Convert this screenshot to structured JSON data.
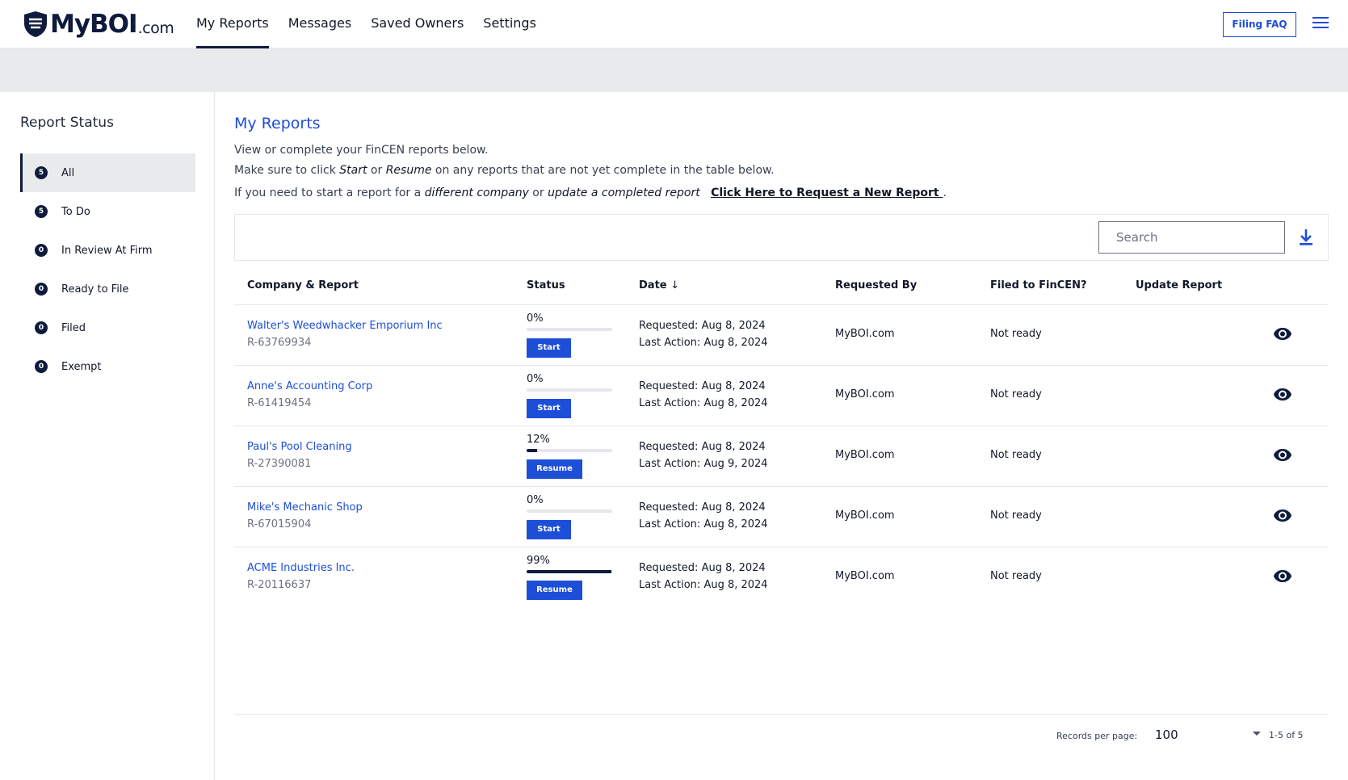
{
  "header": {
    "logo_brand": "MyBOI",
    "logo_suffix": ".com",
    "nav": [
      {
        "label": "My Reports",
        "active": true
      },
      {
        "label": "Messages",
        "active": false
      },
      {
        "label": "Saved Owners",
        "active": false
      },
      {
        "label": "Settings",
        "active": false
      }
    ],
    "faq_label": "Filing FAQ",
    "menu_icon": "hamburger-icon"
  },
  "sidebar": {
    "title": "Report Status",
    "items": [
      {
        "count": "5",
        "label": "All",
        "active": true
      },
      {
        "count": "5",
        "label": "To Do",
        "active": false
      },
      {
        "count": "0",
        "label": "In Review At Firm",
        "active": false
      },
      {
        "count": "0",
        "label": "Ready to File",
        "active": false
      },
      {
        "count": "0",
        "label": "Filed",
        "active": false
      },
      {
        "count": "0",
        "label": "Exempt",
        "active": false
      }
    ]
  },
  "main": {
    "title": "My Reports",
    "line1": "View or complete your FinCEN reports below.",
    "line2_a": "Make sure to click ",
    "line2_b": "Start",
    "line2_c": " or ",
    "line2_d": "Resume",
    "line2_e": " on any reports that are not yet complete in the table below.",
    "line3_a": "If you need to start a report for a ",
    "line3_b": "different company",
    "line3_c": " or ",
    "line3_d": "update a completed report",
    "line3_link": "Click Here to Request a New Report ",
    "line3_end": ".",
    "search_placeholder": "Search",
    "download_icon": "download-icon"
  },
  "table": {
    "headers": {
      "company": "Company & Report",
      "status": "Status",
      "date": "Date",
      "requested_by": "Requested By",
      "filed": "Filed to FinCEN?",
      "update": "Update Report"
    },
    "rows": [
      {
        "company": "Walter's Weedwhacker Emporium Inc",
        "id": "R-63769934",
        "pct_label": "0%",
        "progress": 0,
        "action": "Start",
        "requested": "Requested: Aug 8, 2024",
        "last_action": "Last Action: Aug 8, 2024",
        "requested_by": "MyBOI.com",
        "filed": "Not ready"
      },
      {
        "company": "Anne's Accounting Corp",
        "id": "R-61419454",
        "pct_label": "0%",
        "progress": 0,
        "action": "Start",
        "requested": "Requested: Aug 8, 2024",
        "last_action": "Last Action: Aug 8, 2024",
        "requested_by": "MyBOI.com",
        "filed": "Not ready"
      },
      {
        "company": "Paul's Pool Cleaning",
        "id": "R-27390081",
        "pct_label": "12%",
        "progress": 12,
        "action": "Resume",
        "requested": "Requested: Aug 8, 2024",
        "last_action": "Last Action: Aug 9, 2024",
        "requested_by": "MyBOI.com",
        "filed": "Not ready"
      },
      {
        "company": "Mike's Mechanic Shop",
        "id": "R-67015904",
        "pct_label": "0%",
        "progress": 0,
        "action": "Start",
        "requested": "Requested: Aug 8, 2024",
        "last_action": "Last Action: Aug 8, 2024",
        "requested_by": "MyBOI.com",
        "filed": "Not ready"
      },
      {
        "company": "ACME Industries Inc.",
        "id": "R-20116637",
        "pct_label": "99%",
        "progress": 99,
        "action": "Resume",
        "requested": "Requested: Aug 8, 2024",
        "last_action": "Last Action: Aug 8, 2024",
        "requested_by": "MyBOI.com",
        "filed": "Not ready"
      }
    ]
  },
  "pager": {
    "label": "Records per page:",
    "per_page": "100",
    "range": "1-5 of 5"
  },
  "colors": {
    "accent": "#1d4ed8",
    "navy": "#0f1b3d",
    "banner": "#e9eaec"
  }
}
